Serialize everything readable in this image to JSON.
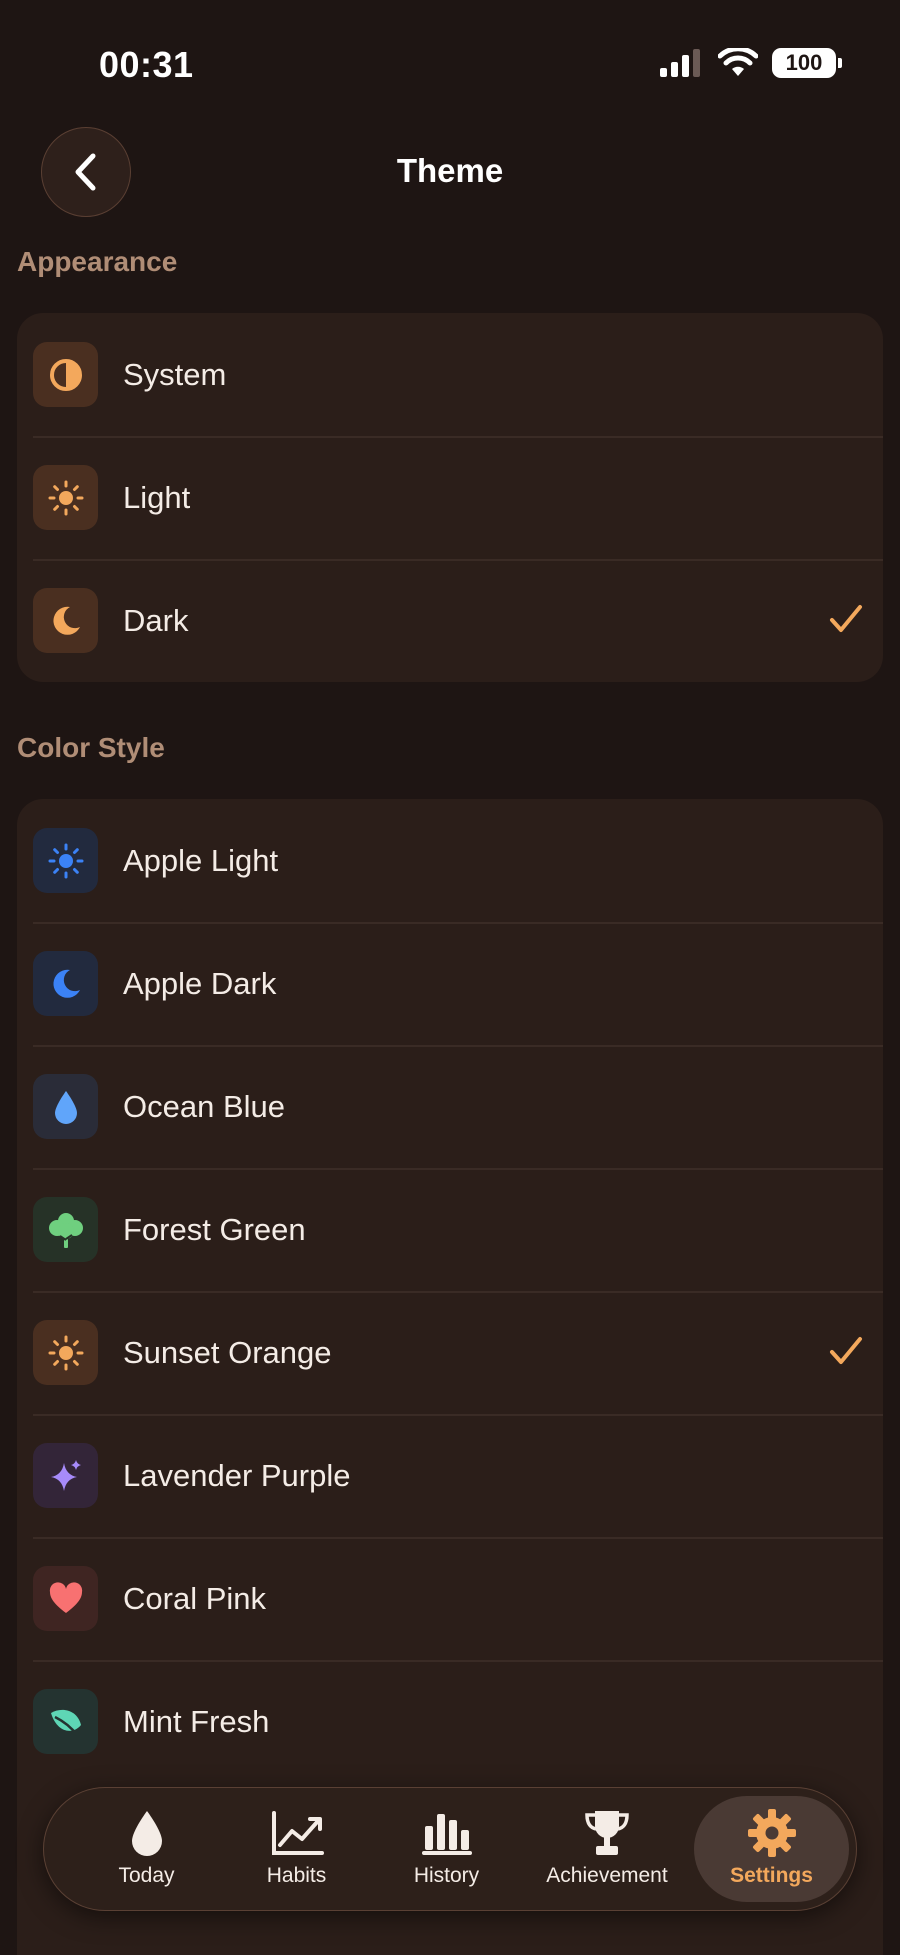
{
  "status_bar": {
    "time": "00:31",
    "battery": "100"
  },
  "header": {
    "title": "Theme"
  },
  "appearance": {
    "section_title": "Appearance",
    "items": [
      {
        "label": "System",
        "icon": "half-circle-icon",
        "selected": false
      },
      {
        "label": "Light",
        "icon": "sun-icon",
        "selected": false
      },
      {
        "label": "Dark",
        "icon": "moon-icon",
        "selected": true
      }
    ]
  },
  "color_style": {
    "section_title": "Color Style",
    "items": [
      {
        "label": "Apple Light",
        "icon": "sun-icon",
        "color": "#3b82f6",
        "selected": false
      },
      {
        "label": "Apple Dark",
        "icon": "moon-icon",
        "color": "#3b82f6",
        "selected": false
      },
      {
        "label": "Ocean Blue",
        "icon": "drop-icon",
        "color": "#60a5fa",
        "selected": false
      },
      {
        "label": "Forest Green",
        "icon": "tree-icon",
        "color": "#6fcf7f",
        "selected": false
      },
      {
        "label": "Sunset Orange",
        "icon": "sun-icon",
        "color": "#f3a85c",
        "selected": true
      },
      {
        "label": "Lavender Purple",
        "icon": "sparkles-icon",
        "color": "#a78bfa",
        "selected": false
      },
      {
        "label": "Coral Pink",
        "icon": "heart-icon",
        "color": "#f87171",
        "selected": false
      },
      {
        "label": "Mint Fresh",
        "icon": "leaf-icon",
        "color": "#5ed6b5",
        "selected": false
      }
    ]
  },
  "tab_bar": {
    "tabs": [
      {
        "label": "Today",
        "icon": "drop-icon",
        "active": false
      },
      {
        "label": "Habits",
        "icon": "chart-line-icon",
        "active": false
      },
      {
        "label": "History",
        "icon": "bar-chart-icon",
        "active": false
      },
      {
        "label": "Achievement",
        "icon": "trophy-icon",
        "active": false
      },
      {
        "label": "Settings",
        "icon": "gear-icon",
        "active": true
      }
    ]
  },
  "colors": {
    "accent": "#f3a85c",
    "background": "#1e1513",
    "card": "#2b1e19"
  }
}
